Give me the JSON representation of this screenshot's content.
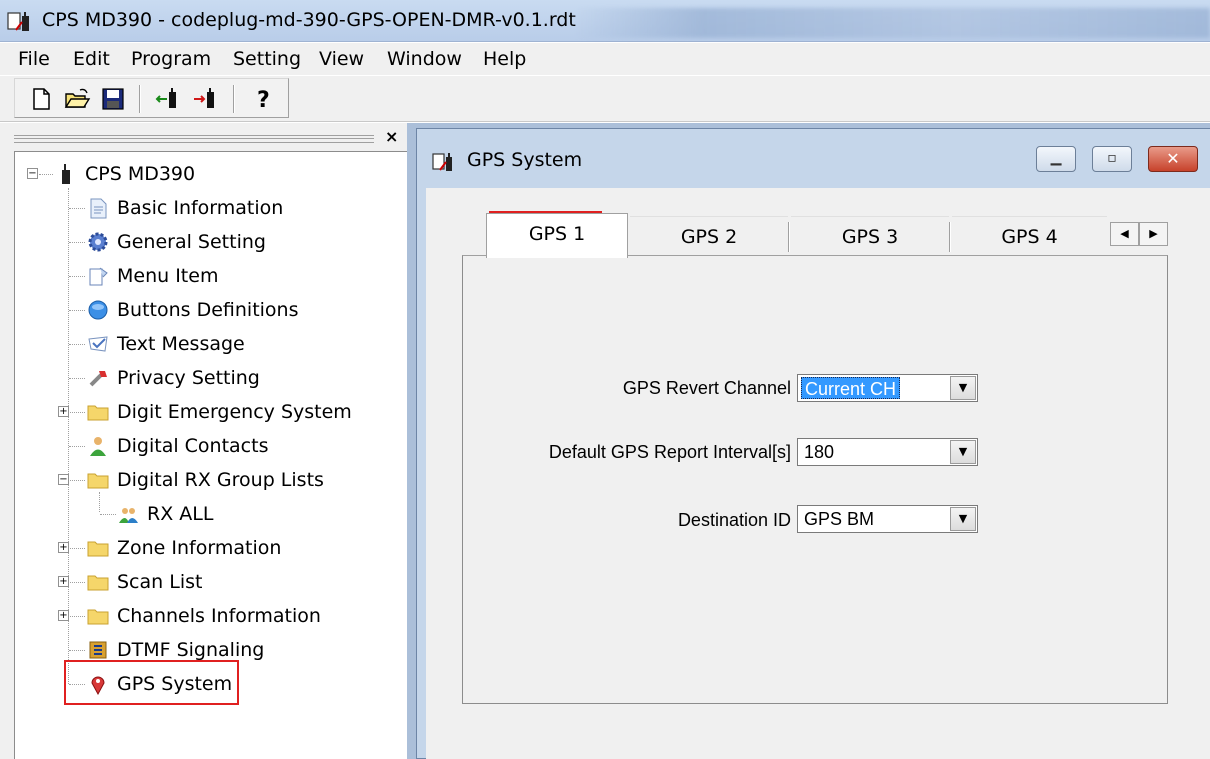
{
  "window": {
    "title": "CPS MD390 - codeplug-md-390-GPS-OPEN-DMR-v0.1.rdt"
  },
  "menu": [
    "File",
    "Edit",
    "Program",
    "Setting",
    "View",
    "Window",
    "Help"
  ],
  "toolbar": {
    "buttons": [
      "new-file-icon",
      "open-folder-icon",
      "save-icon",
      "read-from-radio-icon",
      "write-to-radio-icon",
      "help-icon"
    ]
  },
  "tree": {
    "close_glyph": "×",
    "root": "CPS MD390",
    "items": [
      {
        "label": "Basic Information",
        "icon": "document-icon"
      },
      {
        "label": "General Setting",
        "icon": "gear-icon"
      },
      {
        "label": "Menu Item",
        "icon": "menu-item-icon"
      },
      {
        "label": "Buttons Definitions",
        "icon": "globe-button-icon"
      },
      {
        "label": "Text Message",
        "icon": "message-icon"
      },
      {
        "label": "Privacy Setting",
        "icon": "wrench-icon"
      },
      {
        "label": "Digit Emergency System",
        "icon": "folder-icon"
      },
      {
        "label": "Digital Contacts",
        "icon": "contact-person-icon"
      },
      {
        "label": "Digital RX Group Lists",
        "icon": "folder-icon"
      },
      {
        "label": "RX ALL",
        "icon": "group-icon"
      },
      {
        "label": "Zone Information",
        "icon": "folder-icon"
      },
      {
        "label": "Scan List",
        "icon": "folder-icon"
      },
      {
        "label": "Channels Information",
        "icon": "folder-icon"
      },
      {
        "label": "DTMF Signaling",
        "icon": "dtmf-icon"
      },
      {
        "label": "GPS System",
        "icon": "gps-pin-icon"
      }
    ]
  },
  "child_window": {
    "title": "GPS System",
    "tabs": [
      "GPS 1",
      "GPS 2",
      "GPS 3",
      "GPS 4"
    ],
    "selected_tab": "GPS 1"
  },
  "form": {
    "revert_channel": {
      "label": "GPS Revert Channel",
      "value": "Current CH"
    },
    "report_interval": {
      "label": "Default GPS Report Interval[s]",
      "value": "180"
    },
    "destination_id": {
      "label": "Destination ID",
      "value": "GPS BM"
    }
  },
  "colors": {
    "highlight_box": "#e02020",
    "selection": "#3399ff",
    "mdi_background": "#abbfd9"
  }
}
